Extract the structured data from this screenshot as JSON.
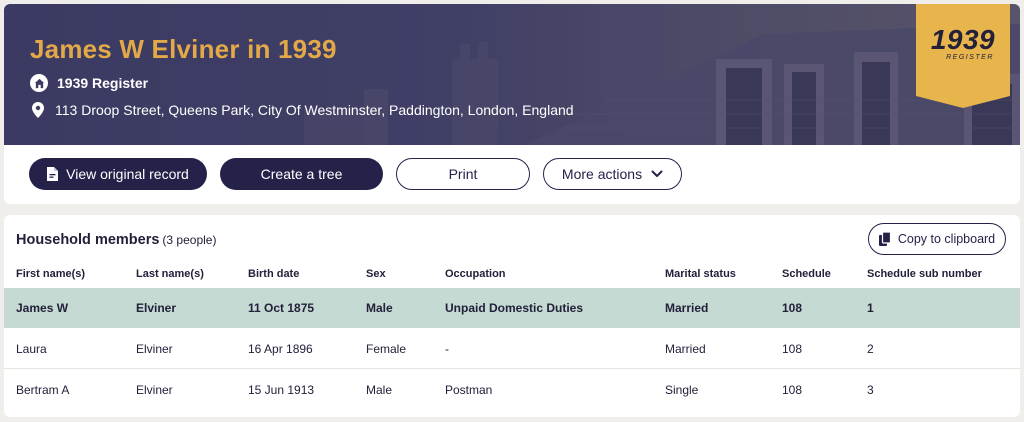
{
  "header": {
    "title": "James W Elviner in 1939",
    "register_label": "1939 Register",
    "address": "113 Droop Street, Queens Park, City Of Westminster, Paddington, London, England",
    "badge": {
      "year": "1939",
      "subtitle": "REGISTER"
    },
    "icons": {
      "register": "home-icon",
      "address": "location-pin-icon"
    }
  },
  "actions": {
    "view_original": "View original record",
    "create_tree": "Create a tree",
    "print": "Print",
    "more_actions": "More actions"
  },
  "household": {
    "title": "Household members",
    "count": "(3 people)",
    "copy_label": "Copy to clipboard",
    "columns": [
      "First name(s)",
      "Last name(s)",
      "Birth date",
      "Sex",
      "Occupation",
      "Marital status",
      "Schedule",
      "Schedule sub number"
    ],
    "rows": [
      [
        "James W",
        "Elviner",
        "11 Oct 1875",
        "Male",
        "Unpaid Domestic Duties",
        "Married",
        "108",
        "1"
      ],
      [
        "Laura",
        "Elviner",
        "16 Apr 1896",
        "Female",
        "-",
        "Married",
        "108",
        "2"
      ],
      [
        "Bertram A",
        "Elviner",
        "15 Jun 1913",
        "Male",
        "Postman",
        "Single",
        "108",
        "3"
      ]
    ],
    "highlighted_row": 0
  },
  "colors": {
    "navy": "#25224a",
    "gold": "#e3a948",
    "badge": "#e8b54d",
    "highlight": "#c4dad3"
  }
}
